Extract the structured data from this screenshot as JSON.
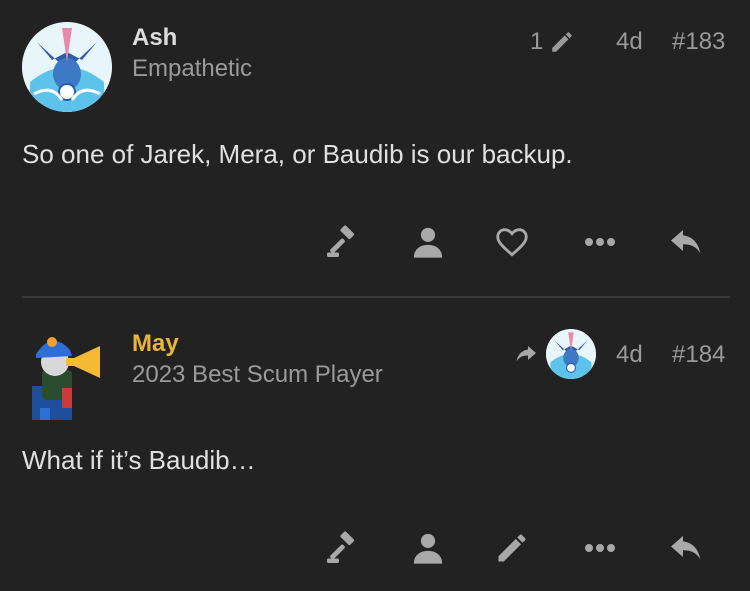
{
  "posts": [
    {
      "username": "Ash",
      "user_title": "Empathetic",
      "edit_count": "1",
      "age": "4d",
      "post_number": "#183",
      "body": "So one of Jarek, Mera, or Baudib is our backup.",
      "actions": [
        "gavel-icon",
        "user-icon",
        "heart-icon",
        "more-icon",
        "reply-icon"
      ]
    },
    {
      "username": "May",
      "user_title": "2023 Best Scum Player",
      "age": "4d",
      "post_number": "#184",
      "body": "What if it’s Baudib…",
      "actions": [
        "gavel-icon",
        "user-icon",
        "pencil-icon",
        "more-icon",
        "reply-icon"
      ]
    }
  ],
  "colors": {
    "background": "#222222",
    "username_default": "#dddddd",
    "username_highlight": "#e9b43b",
    "muted": "#9a9a9a",
    "icon": "#a8a8a8"
  }
}
